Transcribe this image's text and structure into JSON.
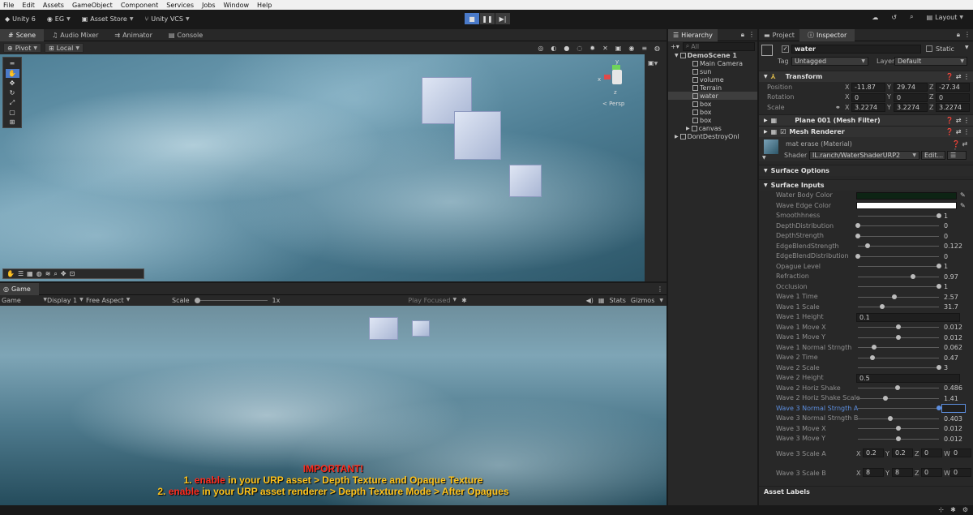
{
  "menu": [
    "File",
    "Edit",
    "Assets",
    "GameObject",
    "Component",
    "Services",
    "Jobs",
    "Window",
    "Help"
  ],
  "toolbar": {
    "product": "Unity 6",
    "account": "EG",
    "asset_store": "Asset Store",
    "vcs": "Unity VCS",
    "layout": "Layout"
  },
  "scene": {
    "tabs": [
      "Scene",
      "Audio Mixer",
      "Animator",
      "Console"
    ],
    "pivot": "Pivot",
    "local": "Local",
    "persp": "< Persp",
    "gizmo_x": "x",
    "gizmo_y": "y",
    "gizmo_z": "z"
  },
  "game": {
    "tab": "Game",
    "game_dd": "Game",
    "display": "Display 1",
    "aspect": "Free Aspect",
    "scale_label": "Scale",
    "scale_value": "1x",
    "play_focused": "Play Focused",
    "stats": "Stats",
    "gizmos": "Gizmos",
    "important": {
      "title": "IMPORTANT!",
      "line1_num": "1. ",
      "line1_hl": "enable",
      "line1_rest": " in your URP asset > Depth Texture and Opaque Texture",
      "line2_num": "2. ",
      "line2_hl": "enable",
      "line2_rest": " in your URP asset renderer > Depth Texture Mode > After Opagues"
    }
  },
  "hierarchy": {
    "tab": "Hierarchy",
    "search": "All",
    "items": [
      {
        "label": "DemoScene 1",
        "indent": 0,
        "bold": true,
        "arrow": "▼"
      },
      {
        "label": "Main Camera",
        "indent": 1
      },
      {
        "label": "sun",
        "indent": 1
      },
      {
        "label": "volume",
        "indent": 1
      },
      {
        "label": "Terrain",
        "indent": 1
      },
      {
        "label": "water",
        "indent": 1,
        "sel": true
      },
      {
        "label": "box",
        "indent": 1
      },
      {
        "label": "box",
        "indent": 1
      },
      {
        "label": "box",
        "indent": 1
      },
      {
        "label": "canvas",
        "indent": 1,
        "arrow": "▶"
      },
      {
        "label": "DontDestroyOnl",
        "indent": 0,
        "arrow": "▶"
      }
    ]
  },
  "inspector": {
    "tabs": [
      "Project",
      "Inspector"
    ],
    "name": "water",
    "static": "Static",
    "tag_label": "Tag",
    "tag": "Untagged",
    "layer_label": "Layer",
    "layer": "Default",
    "transform": {
      "title": "Transform",
      "rows": [
        {
          "label": "Position",
          "x": "-11.87",
          "y": "29.74",
          "z": "-27.34"
        },
        {
          "label": "Rotation",
          "x": "0",
          "y": "0",
          "z": "0"
        },
        {
          "label": "Scale",
          "x": "3.2274",
          "y": "3.2274",
          "z": "3.2274"
        }
      ]
    },
    "mesh_filter": "Plane 001 (Mesh Filter)",
    "mesh_renderer": "Mesh Renderer",
    "material": "mat erase (Material)",
    "shader_label": "Shader",
    "shader": "IL.ranch/WaterShaderURP2",
    "edit": "Edit...",
    "surface_options": "Surface Options",
    "surface_inputs": "Surface Inputs",
    "colors": [
      {
        "label": "Water Body Color",
        "color": "#0d2414"
      },
      {
        "label": "Wave Edge Color",
        "color": "#ffffff"
      }
    ],
    "props": [
      {
        "label": "Smoothhness",
        "value": "1",
        "pos": 1
      },
      {
        "label": "DepthDistribution",
        "value": "0",
        "pos": 0
      },
      {
        "label": "DepthStrength",
        "value": "0",
        "pos": 0
      },
      {
        "label": "EdgeBlendStrength",
        "value": "0.122",
        "pos": 0.122
      },
      {
        "label": "EdgeBlendDistribution",
        "value": "0",
        "pos": 0
      },
      {
        "label": "Opague Level",
        "value": "1",
        "pos": 1
      },
      {
        "label": "Refraction",
        "value": "0.97",
        "pos": 0.68
      },
      {
        "label": "Occlusion",
        "value": "1",
        "pos": 1
      },
      {
        "label": "Wave 1 Time",
        "value": "2.57",
        "pos": 0.45
      },
      {
        "label": "Wave 1 Scale",
        "value": "31.7",
        "pos": 0.3
      },
      {
        "label": "Wave 1 Height",
        "value": "0.1",
        "field": true
      },
      {
        "label": "Wave 1 Move X",
        "value": "0.012",
        "pos": 0.5
      },
      {
        "label": "Wave 1 Move Y",
        "value": "0.012",
        "pos": 0.5
      },
      {
        "label": "Wave 1 Normal Strngth",
        "value": "0.062",
        "pos": 0.2
      },
      {
        "label": "Wave 2 Time",
        "value": "0.47",
        "pos": 0.18
      },
      {
        "label": "Wave 2 Scale",
        "value": "3",
        "pos": 1
      },
      {
        "label": "Wave 2 Height",
        "value": "0.5",
        "field": true
      },
      {
        "label": "Wave 2 Horiz Shake",
        "value": "0.486",
        "pos": 0.49
      },
      {
        "label": "Wave 2 Horiz Shake Scale",
        "value": "1.41",
        "pos": 0.34
      },
      {
        "label": "Wave 3 Normal Strngth A",
        "value": "",
        "pos": 1,
        "active": true
      },
      {
        "label": "Wave 3 Normal Strngth B",
        "value": "0.403",
        "pos": 0.4
      },
      {
        "label": "Wave 3 Move X",
        "value": "0.012",
        "pos": 0.5
      },
      {
        "label": "Wave 3 Move Y",
        "value": "0.012",
        "pos": 0.5
      }
    ],
    "scale_a": {
      "label": "Wave 3 Scale A",
      "x": "0.2",
      "y": "0.2",
      "z": "0",
      "w": "0"
    },
    "scale_b": {
      "label": "Wave 3 Scale B",
      "x": "8",
      "y": "8",
      "z": "0",
      "w": "0"
    },
    "asset_labels": "Asset Labels",
    "axes": {
      "x": "X",
      "y": "Y",
      "z": "Z",
      "w": "W"
    }
  }
}
